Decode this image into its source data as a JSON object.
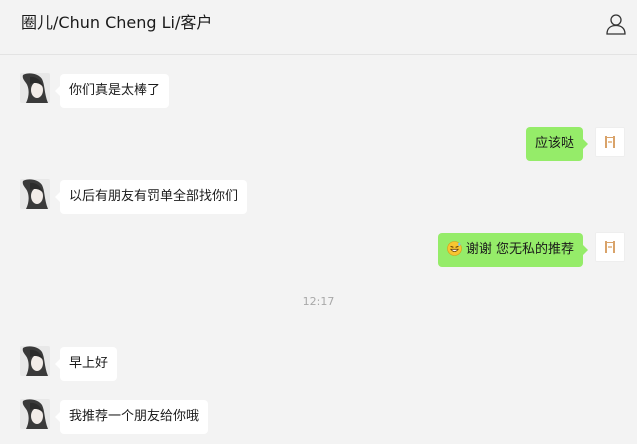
{
  "header": {
    "title": "圈儿/Chun Cheng Li/客户"
  },
  "messages": [
    {
      "side": "left",
      "text": "你们真是太棒了"
    },
    {
      "side": "right",
      "text": "应该哒"
    },
    {
      "side": "left",
      "text": "以后有朋友有罚单全部找你们"
    },
    {
      "side": "right",
      "emoji": "grinning-sweat-emoji",
      "text": "谢谢 您无私的推荐"
    },
    {
      "side": "left",
      "text": "早上好"
    },
    {
      "side": "left",
      "text": "我推荐一个朋友给你哦"
    }
  ],
  "timestamp": "12:17",
  "colors": {
    "outgoing_bubble": "#95ec69",
    "incoming_bubble": "#ffffff",
    "background": "#f3f3f3"
  }
}
